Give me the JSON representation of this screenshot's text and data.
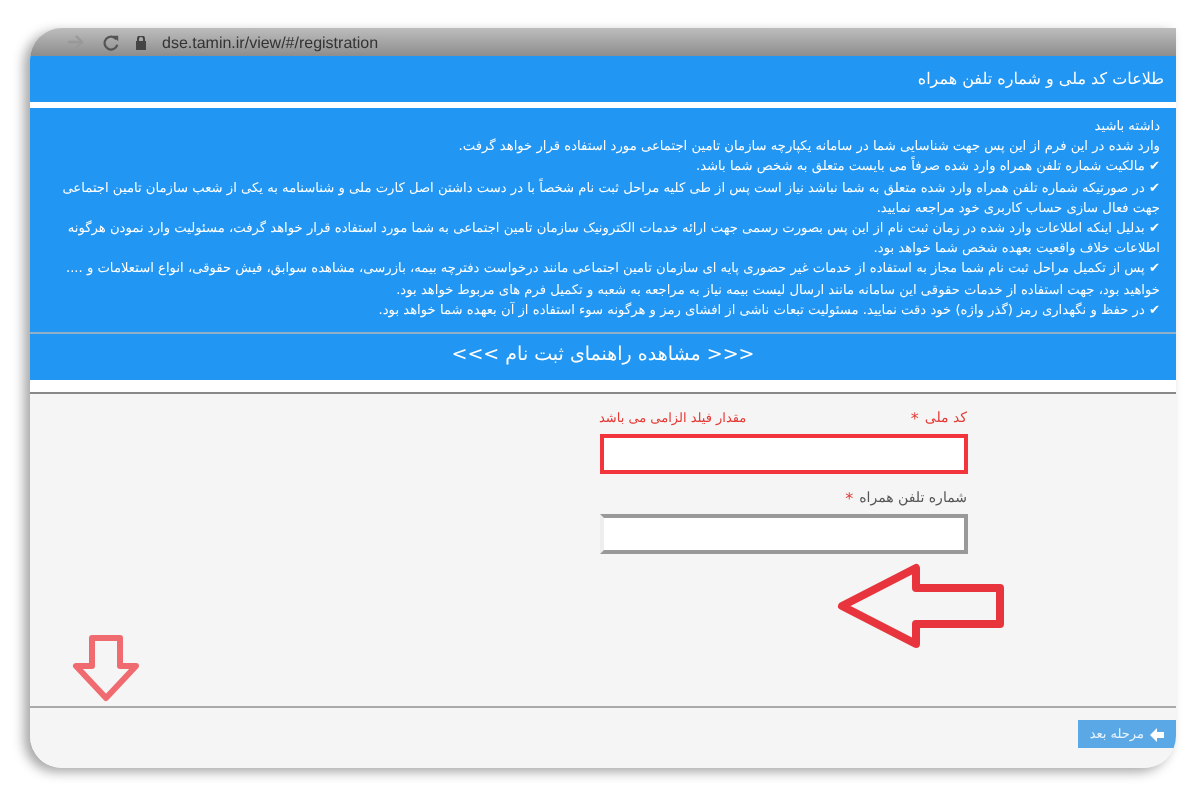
{
  "browser": {
    "url": "dse.tamin.ir/view/#/registration"
  },
  "header": {
    "title": "طلاعات کد ملی و شماره تلفن همراه"
  },
  "notice": {
    "lines": [
      "داشته باشید",
      "وارد شده در این فرم از این پس جهت شناسایی شما در سامانه یکپارچه سازمان تامین اجتماعی مورد استفاده قرار خواهد گرفت.",
      "✔ مالکیت شماره تلفن همراه وارد شده صرفاً می بایست متعلق به شخص شما باشد.",
      "✔ در صورتیکه شماره تلفن همراه وارد شده متعلق به شما نباشد نیاز است پس از طی کلیه مراحل ثبت نام شخصاً با در دست داشتن اصل کارت ملی و شناسنامه به یکی از شعب سازمان تامین اجتماعی جهت فعال سازی حساب کاربری خود مراجعه نمایید.",
      "✔ بدلیل اینکه اطلاعات وارد شده در زمان ثبت نام از این پس بصورت رسمی جهت ارائه خدمات الکترونیک سازمان تامین اجتماعی به شما مورد استفاده قرار خواهد گرفت، مسئولیت وارد نمودن هرگونه اطلاعات خلاف واقعیت بعهده شخص شما خواهد بود.",
      "✔ پس از تکمیل مراحل ثبت نام شما مجاز به استفاده از خدمات غیر حضوری پایه ای سازمان تامین اجتماعی مانند درخواست دفترچه بیمه، بازرسی، مشاهده سوابق، فیش حقوقی، انواع استعلامات و .... خواهید بود، جهت استفاده از خدمات حقوقی این سامانه مانند ارسال لیست بیمه نیاز به مراجعه به شعبه و تکمیل فرم های مربوط خواهد بود.",
      "✔ در حفظ و نگهداری رمز (گذر واژه) خود دقت نمایید. مسئولیت تبعات ناشی از افشای رمز و هرگونه سوء استفاده از آن بعهده شما خواهد بود."
    ],
    "guide_link": "<<< مشاهده راهنمای ثبت نام >>>"
  },
  "form": {
    "fields": [
      {
        "label": "کد ملی",
        "required_mark": "*",
        "error": true,
        "error_text": "مقدار فیلد الزامی می باشد"
      },
      {
        "label": "شماره تلفن همراه",
        "required_mark": "*",
        "error": false
      }
    ],
    "next_button": "مرحله بعد"
  }
}
